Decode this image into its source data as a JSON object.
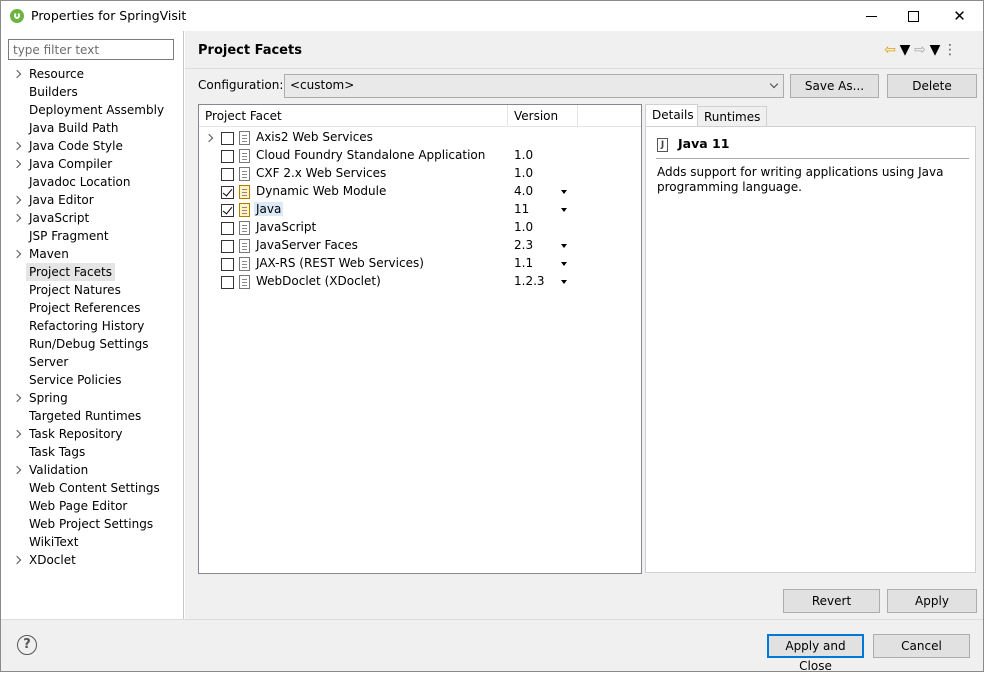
{
  "window": {
    "title": "Properties for SpringVisit",
    "controls": [
      "minimize",
      "maximize",
      "close"
    ],
    "close_glyph": "✕"
  },
  "left": {
    "filter_placeholder": "type filter text",
    "items": [
      {
        "label": "Resource",
        "expandable": true
      },
      {
        "label": "Builders",
        "expandable": false
      },
      {
        "label": "Deployment Assembly",
        "expandable": false
      },
      {
        "label": "Java Build Path",
        "expandable": false
      },
      {
        "label": "Java Code Style",
        "expandable": true
      },
      {
        "label": "Java Compiler",
        "expandable": true
      },
      {
        "label": "Javadoc Location",
        "expandable": false
      },
      {
        "label": "Java Editor",
        "expandable": true
      },
      {
        "label": "JavaScript",
        "expandable": true
      },
      {
        "label": "JSP Fragment",
        "expandable": false
      },
      {
        "label": "Maven",
        "expandable": true
      },
      {
        "label": "Project Facets",
        "expandable": false,
        "selected": true
      },
      {
        "label": "Project Natures",
        "expandable": false
      },
      {
        "label": "Project References",
        "expandable": false
      },
      {
        "label": "Refactoring History",
        "expandable": false
      },
      {
        "label": "Run/Debug Settings",
        "expandable": false
      },
      {
        "label": "Server",
        "expandable": false
      },
      {
        "label": "Service Policies",
        "expandable": false
      },
      {
        "label": "Spring",
        "expandable": true
      },
      {
        "label": "Targeted Runtimes",
        "expandable": false
      },
      {
        "label": "Task Repository",
        "expandable": true
      },
      {
        "label": "Task Tags",
        "expandable": false
      },
      {
        "label": "Validation",
        "expandable": true
      },
      {
        "label": "Web Content Settings",
        "expandable": false
      },
      {
        "label": "Web Page Editor",
        "expandable": false
      },
      {
        "label": "Web Project Settings",
        "expandable": false
      },
      {
        "label": "WikiText",
        "expandable": false
      },
      {
        "label": "XDoclet",
        "expandable": true
      }
    ]
  },
  "main": {
    "heading": "Project Facets",
    "nav": {
      "back_glyph": "⇦",
      "forward_glyph": "⇨",
      "dropdown_glyph": "▼",
      "menu_glyph": "⋮"
    },
    "configuration_label": "Configuration:",
    "configuration_value": "<custom>",
    "save_as_label": "Save As...",
    "delete_label": "Delete",
    "table": {
      "col_facet": "Project Facet",
      "col_version": "Version",
      "rows": [
        {
          "name": "Axis2 Web Services",
          "version": "",
          "checked": false,
          "expandable": true,
          "has_dropdown": false
        },
        {
          "name": "Cloud Foundry Standalone Application",
          "version": "1.0",
          "checked": false,
          "expandable": false,
          "has_dropdown": false
        },
        {
          "name": "CXF 2.x Web Services",
          "version": "1.0",
          "checked": false,
          "expandable": false,
          "has_dropdown": false
        },
        {
          "name": "Dynamic Web Module",
          "version": "4.0",
          "checked": true,
          "expandable": false,
          "has_dropdown": true,
          "special_icon": true
        },
        {
          "name": "Java",
          "version": "11",
          "checked": true,
          "expandable": false,
          "has_dropdown": true,
          "special_icon": true,
          "highlighted": true
        },
        {
          "name": "JavaScript",
          "version": "1.0",
          "checked": false,
          "expandable": false,
          "has_dropdown": false
        },
        {
          "name": "JavaServer Faces",
          "version": "2.3",
          "checked": false,
          "expandable": false,
          "has_dropdown": true
        },
        {
          "name": "JAX-RS (REST Web Services)",
          "version": "1.1",
          "checked": false,
          "expandable": false,
          "has_dropdown": true
        },
        {
          "name": "WebDoclet (XDoclet)",
          "version": "1.2.3",
          "checked": false,
          "expandable": false,
          "has_dropdown": true
        }
      ]
    },
    "details": {
      "tab_details": "Details",
      "tab_runtimes": "Runtimes",
      "icon_letter": "J",
      "title": "Java 11",
      "description": "Adds support for writing applications using Java programming language."
    },
    "revert_label": "Revert",
    "apply_label": "Apply"
  },
  "bottom": {
    "help_glyph": "?",
    "apply_close_label": "Apply and Close",
    "cancel_label": "Cancel"
  }
}
